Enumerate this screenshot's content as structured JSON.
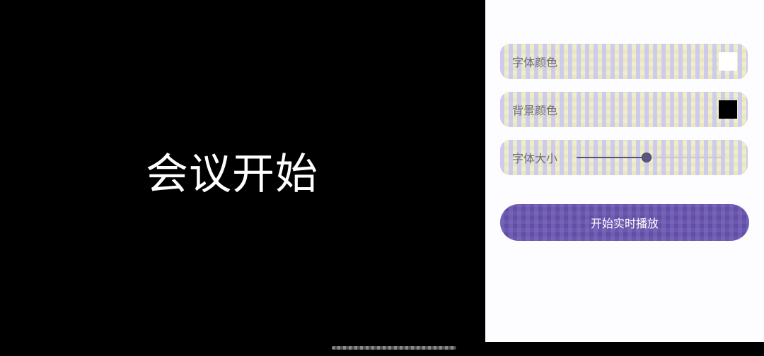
{
  "preview": {
    "text": "会议开始",
    "text_color": "#ffffff",
    "background_color": "#000000"
  },
  "settings": {
    "font_color": {
      "label": "字体颜色",
      "value": "#ffffff"
    },
    "background_color": {
      "label": "背景颜色",
      "value": "#000000"
    },
    "font_size": {
      "label": "字体大小",
      "level": 0.48
    }
  },
  "actions": {
    "start_label": "开始实时播放",
    "accent_color": "#6651a6"
  }
}
